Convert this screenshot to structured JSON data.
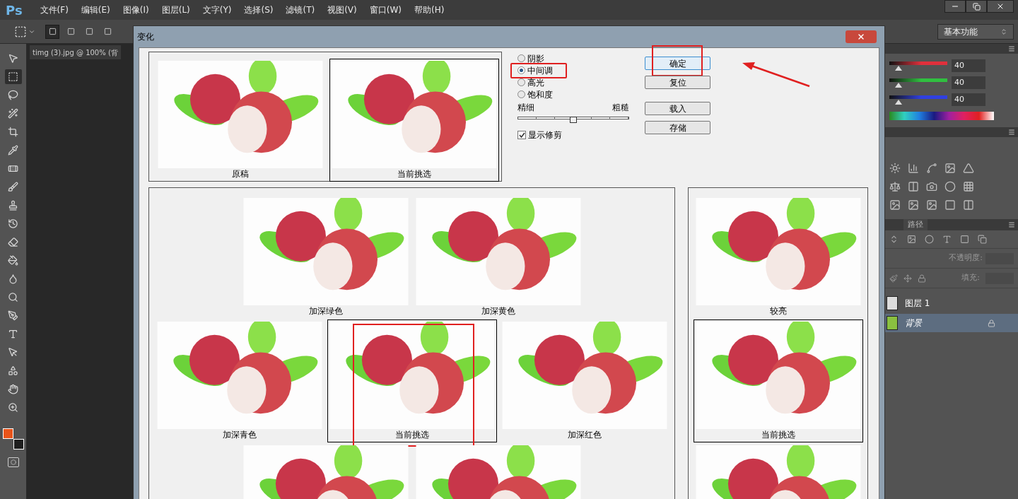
{
  "app": {
    "logo": "Ps",
    "menu": [
      "文件(F)",
      "编辑(E)",
      "图像(I)",
      "图层(L)",
      "文字(Y)",
      "选择(S)",
      "滤镜(T)",
      "视图(V)",
      "窗口(W)",
      "帮助(H)"
    ]
  },
  "workspace": "基本功能",
  "selection_modes": [
    {
      "selected": true
    },
    {
      "selected": false
    },
    {
      "selected": false
    },
    {
      "selected": false
    }
  ],
  "document_tab": "timg (3).jpg @ 100% (背",
  "tools": [
    {
      "kind": "move",
      "selected": false
    },
    {
      "kind": "marquee",
      "selected": true
    },
    {
      "kind": "lasso",
      "selected": false
    },
    {
      "kind": "wand",
      "selected": false
    },
    {
      "kind": "crop",
      "selected": false
    },
    {
      "kind": "eyedropper",
      "selected": false
    },
    {
      "kind": "heal",
      "selected": false
    },
    {
      "kind": "brush",
      "selected": false
    },
    {
      "kind": "stamp",
      "selected": false
    },
    {
      "kind": "history",
      "selected": false
    },
    {
      "kind": "eraser",
      "selected": false
    },
    {
      "kind": "bucket",
      "selected": false
    },
    {
      "kind": "blur",
      "selected": false
    },
    {
      "kind": "dodge",
      "selected": false
    },
    {
      "kind": "pen",
      "selected": false
    },
    {
      "kind": "type",
      "selected": false
    },
    {
      "kind": "path",
      "selected": false
    },
    {
      "kind": "shape",
      "selected": false
    },
    {
      "kind": "hand",
      "selected": false
    },
    {
      "kind": "zoom",
      "selected": false
    }
  ],
  "swatches": [
    {
      "kind": "foreground",
      "color": "#e8541a"
    },
    {
      "kind": "background",
      "color": "#1e1e1e"
    }
  ],
  "dialog": {
    "title": "变化",
    "originals": [
      {
        "caption": "原稿",
        "kind": "original"
      },
      {
        "caption": "当前挑选",
        "kind": "current"
      }
    ],
    "tones": [
      {
        "label": "阴影",
        "selected": false,
        "highlighted": false
      },
      {
        "label": "中间调",
        "selected": true,
        "highlighted": true
      },
      {
        "label": "高光",
        "selected": false,
        "highlighted": false
      },
      {
        "label": "饱和度",
        "selected": false,
        "highlighted": false
      }
    ],
    "fine_label": "精细",
    "coarse_label": "粗糙",
    "amount": {
      "level": 0.5
    },
    "show_clipping": {
      "label": "显示修剪",
      "checked": true
    },
    "buttons": [
      {
        "label": "确定",
        "default": true,
        "highlighted": true,
        "arrow": true
      },
      {
        "label": "复位",
        "default": false,
        "highlighted": false,
        "arrow": false
      },
      {
        "label": "载入",
        "default": false,
        "highlighted": false,
        "arrow": false
      },
      {
        "label": "存储",
        "default": false,
        "highlighted": false,
        "arrow": false
      }
    ],
    "variation_rows": [
      [
        {
          "caption": "加深绿色",
          "kind": "variation",
          "highlighted": false
        },
        {
          "caption": "加深黄色",
          "kind": "variation",
          "highlighted": false
        }
      ],
      [
        {
          "caption": "加深青色",
          "kind": "variation",
          "highlighted": false
        },
        {
          "caption": "当前挑选",
          "kind": "current",
          "highlighted": true
        },
        {
          "caption": "加深红色",
          "kind": "variation",
          "highlighted": false
        }
      ],
      [
        {
          "kind": "variation",
          "highlighted": false
        },
        {
          "kind": "variation",
          "highlighted": false
        }
      ]
    ],
    "brightness": [
      {
        "caption": "较亮",
        "kind": "variation"
      },
      {
        "caption": "当前挑选",
        "kind": "current"
      },
      {
        "kind": "variation"
      }
    ]
  },
  "color_panel": {
    "channels": [
      {
        "value": "40",
        "level": 0.16,
        "color": "#e0303c"
      },
      {
        "value": "40",
        "level": 0.16,
        "color": "#30c040"
      },
      {
        "value": "40",
        "level": 0.16,
        "color": "#3040e0"
      }
    ]
  },
  "layers_panel": {
    "tab": "路径",
    "opacity_label": "不透明度:",
    "fill_label": "填充:",
    "layers": [
      {
        "name": "图层 1",
        "selected": false,
        "locked": false,
        "kind": "transparent"
      },
      {
        "name": "背景",
        "selected": true,
        "locked": true,
        "kind": "image"
      }
    ]
  }
}
